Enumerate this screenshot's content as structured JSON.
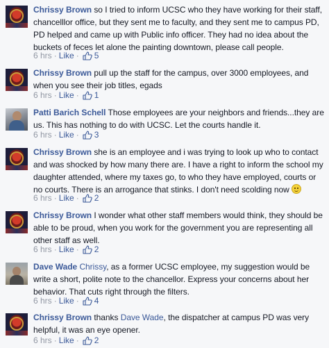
{
  "colors": {
    "link": "#3b5998",
    "meta": "#9197a3",
    "text": "#141823",
    "background": "#f6f7f9"
  },
  "icons": {
    "likes": "thumbs-up-outline-icon",
    "emoji": "smiley-icon"
  },
  "comments": [
    {
      "author": "Chrissy Brown",
      "text": "so I tried to inform UCSC who they have working for their staff, chancelllor office, but they sent me to faculty, and they sent me to campus PD, PD helped and came up with Public info officer. They had no idea about the buckets of feces let alone the painting downtown, please call people.",
      "time": "6 hrs",
      "like_label": "Like",
      "likes": "5"
    },
    {
      "author": "Chrissy Brown",
      "text": "pull up the staff for the campus, over 3000 employees, and when you see their job titles, egads",
      "time": "6 hrs",
      "like_label": "Like",
      "likes": "1"
    },
    {
      "author": "Patti Barich Schell",
      "text": "Those employees are your neighbors and friends...they are us. This has nothing to do with UCSC. Let the courts handle it.",
      "time": "6 hrs",
      "like_label": "Like",
      "likes": "3"
    },
    {
      "author": "Chrissy Brown",
      "text": "she is an employee and i was trying to look up who to contact and was shocked by how many there are. I have a right to inform the school my daughter attended, where my taxes go, to who they have employed, courts or no courts. There is an arrogance that stinks. I don't need scolding now",
      "time": "6 hrs",
      "like_label": "Like",
      "likes": "2"
    },
    {
      "author": "Chrissy Brown",
      "text": "I wonder what other staff members would think, they should be able to be proud, when you work for the government you are representing all other staff as well.",
      "time": "6 hrs",
      "like_label": "Like",
      "likes": "2"
    },
    {
      "author": "Dave Wade",
      "mention": "Chrissy",
      "text": ", as a former UCSC employee, my suggestion would be write a short, polite note to the chancellor. Express your concerns about her behavior. That cuts right through the filters.",
      "time": "6 hrs",
      "like_label": "Like",
      "likes": "4"
    },
    {
      "author": "Chrissy Brown",
      "text_before": "thanks",
      "mention": "Dave Wade",
      "text": ", the dispatcher at campus PD was very helpful, it was an eye opener.",
      "time": "6 hrs",
      "like_label": "Like",
      "likes": "2"
    }
  ]
}
